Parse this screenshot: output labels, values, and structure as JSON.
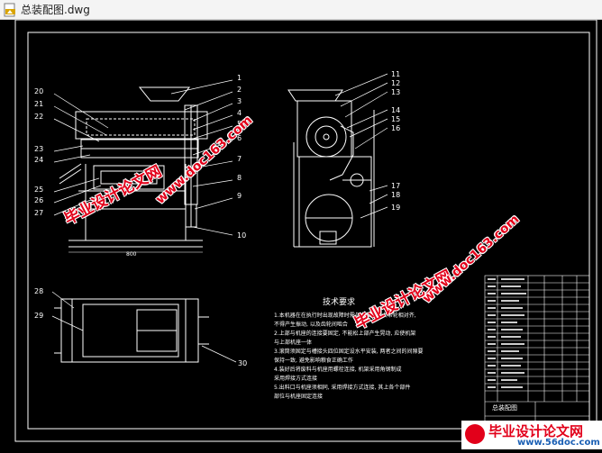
{
  "window": {
    "title": "总装配图.dwg",
    "icon": "dwg-file-icon"
  },
  "drawing": {
    "leader_numbers_left": [
      "20",
      "21",
      "22",
      "23",
      "24",
      "25",
      "26",
      "27"
    ],
    "leader_numbers_right": [
      "1",
      "2",
      "3",
      "4",
      "5",
      "6",
      "7",
      "8",
      "9",
      "10"
    ],
    "side_view_numbers": [
      "11",
      "12",
      "13",
      "14",
      "15",
      "16",
      "17",
      "18",
      "19"
    ],
    "plan_view_numbers": [
      "28",
      "29",
      "30"
    ],
    "dimension_label": "800",
    "notes_title": "技术要求",
    "notes": [
      "1.本机器在在执行时出现故障时需与主轴上的大带轮相对齐,",
      "不得产生振动, 以及齿轮间啮合",
      "2.上部与机座的连接要固定, 不能松上部产生晃动, 应使机架",
      "与上部机座一体",
      "3.滚筒须固定与槽接头四位固定设水平安装, 两者之间的间隙要",
      "保持一致, 避免影响粮食正确工作",
      "4.装好后将废料与机座用螺栓连接, 机架采用角钢制成",
      "采用焊接方式连接",
      "5.出料口与机座须相同, 采用焊接方式连接, 其上各个部件",
      "部位与机座固定连接"
    ],
    "title_block_name": "总装配图"
  },
  "watermarks": {
    "site_name": "毕业设计论文网",
    "site_url": "www.doc163.com",
    "brand_name": "毕业设计论文网",
    "brand_url": "www.56doc.com"
  },
  "colors": {
    "background": "#000000",
    "line": "#ffffff",
    "watermark": "#e2001a"
  }
}
